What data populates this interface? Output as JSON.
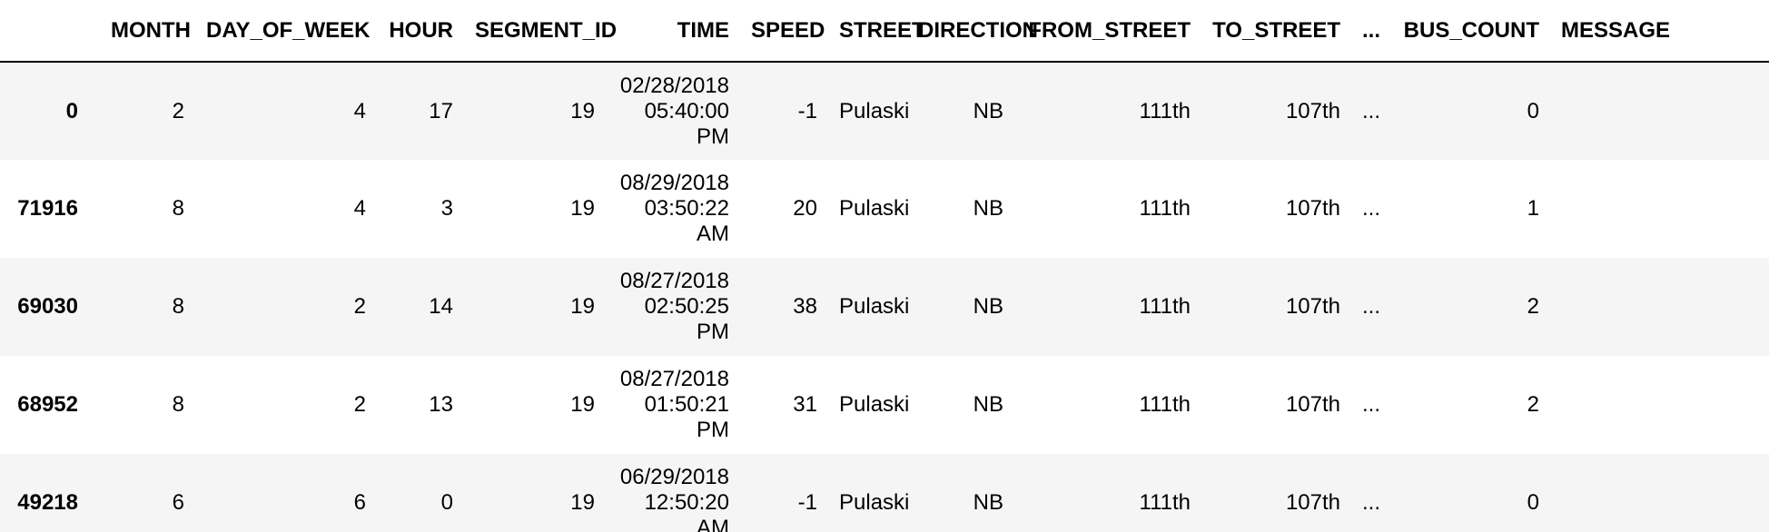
{
  "columns": [
    "MONTH",
    "DAY_OF_WEEK",
    "HOUR",
    "SEGMENT_ID",
    "TIME",
    "SPEED",
    "STREET",
    "DIRECTION",
    "FROM_STREET",
    "TO_STREET",
    "...",
    "BUS_COUNT",
    "MESSAGE"
  ],
  "rows": [
    {
      "index": "0",
      "month": "2",
      "day_of_week": "4",
      "hour": "17",
      "segment_id": "19",
      "time_date": "02/28/2018",
      "time_clock": "05:40:00",
      "time_ampm": "PM",
      "speed": "-1",
      "street": "Pulaski",
      "direction": "NB",
      "from_street": "111th",
      "to_street": "107th",
      "ellipsis": "...",
      "bus_count": "0",
      "message": ""
    },
    {
      "index": "71916",
      "month": "8",
      "day_of_week": "4",
      "hour": "3",
      "segment_id": "19",
      "time_date": "08/29/2018",
      "time_clock": "03:50:22",
      "time_ampm": "AM",
      "speed": "20",
      "street": "Pulaski",
      "direction": "NB",
      "from_street": "111th",
      "to_street": "107th",
      "ellipsis": "...",
      "bus_count": "1",
      "message": ""
    },
    {
      "index": "69030",
      "month": "8",
      "day_of_week": "2",
      "hour": "14",
      "segment_id": "19",
      "time_date": "08/27/2018",
      "time_clock": "02:50:25",
      "time_ampm": "PM",
      "speed": "38",
      "street": "Pulaski",
      "direction": "NB",
      "from_street": "111th",
      "to_street": "107th",
      "ellipsis": "...",
      "bus_count": "2",
      "message": ""
    },
    {
      "index": "68952",
      "month": "8",
      "day_of_week": "2",
      "hour": "13",
      "segment_id": "19",
      "time_date": "08/27/2018",
      "time_clock": "01:50:21",
      "time_ampm": "PM",
      "speed": "31",
      "street": "Pulaski",
      "direction": "NB",
      "from_street": "111th",
      "to_street": "107th",
      "ellipsis": "...",
      "bus_count": "2",
      "message": ""
    },
    {
      "index": "49218",
      "month": "6",
      "day_of_week": "6",
      "hour": "0",
      "segment_id": "19",
      "time_date": "06/29/2018",
      "time_clock": "12:50:20",
      "time_ampm": "AM",
      "speed": "-1",
      "street": "Pulaski",
      "direction": "NB",
      "from_street": "111th",
      "to_street": "107th",
      "ellipsis": "...",
      "bus_count": "0",
      "message": ""
    }
  ],
  "colors": {
    "row_stripe": "#f5f5f5",
    "row_plain": "#ffffff",
    "text": "#000000",
    "header_rule": "#000000"
  }
}
